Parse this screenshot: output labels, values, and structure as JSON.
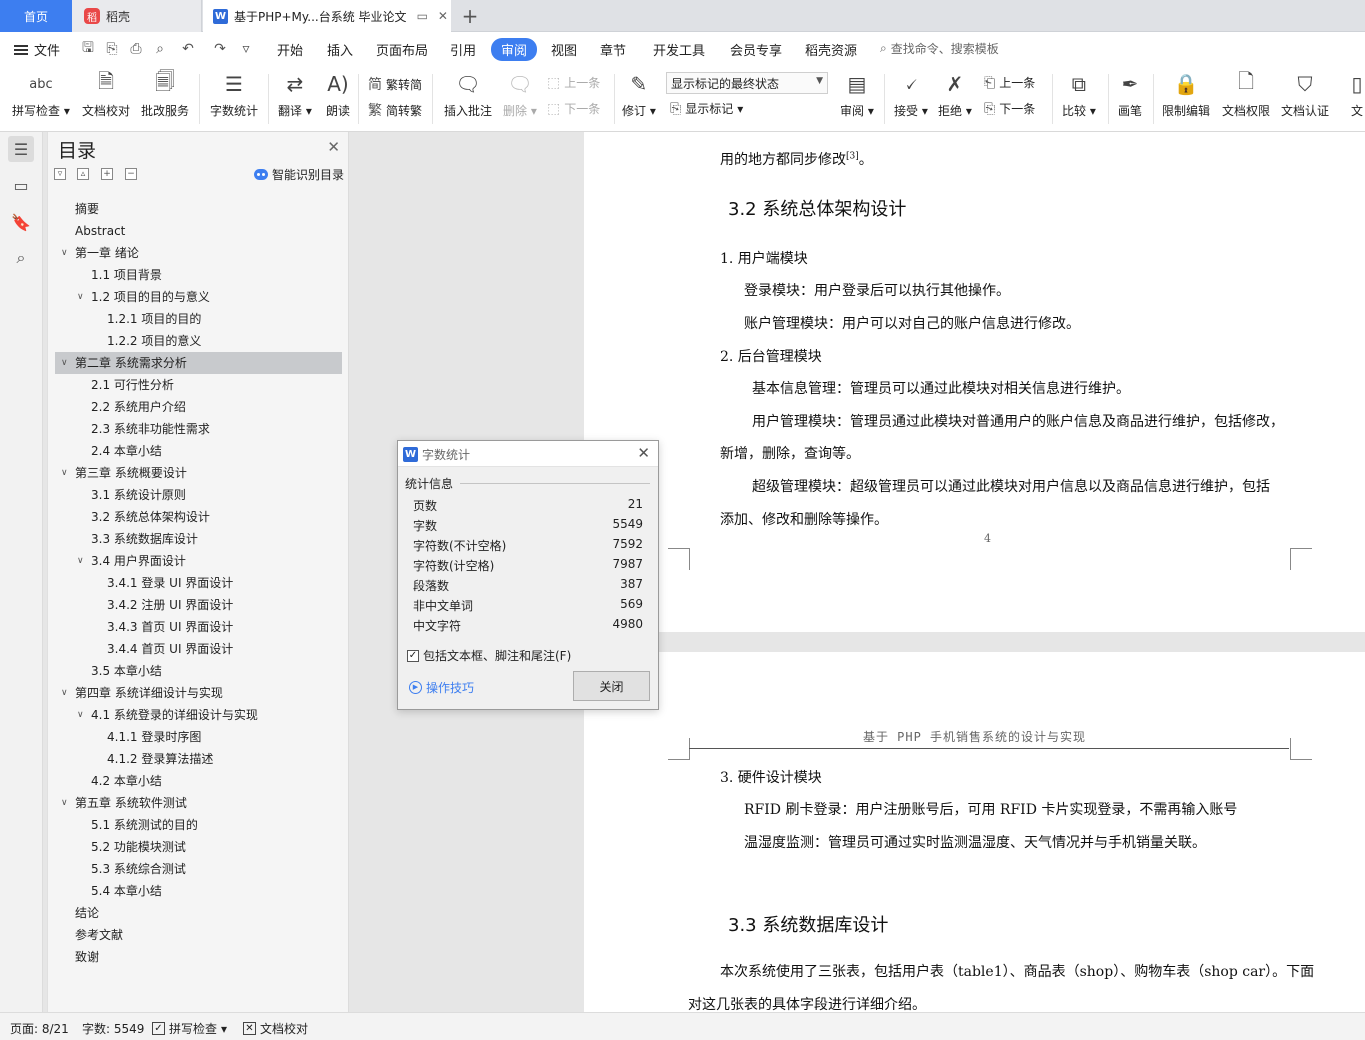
{
  "tabs": {
    "home": "首页",
    "daoke": "稻壳",
    "doc": "基于PHP+My...台系统 毕业论文"
  },
  "menubar": {
    "file": "文件",
    "items": [
      "开始",
      "插入",
      "页面布局",
      "引用",
      "审阅",
      "视图",
      "章节",
      "开发工具",
      "会员专享",
      "稻壳资源"
    ],
    "active": "审阅",
    "search": "查找命令、搜索模板"
  },
  "ribbon": {
    "spell_check": "拼写检查",
    "doc_proof": "文档校对",
    "batch_service": "批改服务",
    "word_count": "字数统计",
    "translate": "翻译",
    "read_aloud": "朗读",
    "trad_to_simp": "繁转简",
    "simp_to_trad": "简转繁",
    "insert_comment": "插入批注",
    "delete": "删除",
    "prev_comment": "上一条",
    "next_comment": "下一条",
    "track_changes": "修订",
    "markup_mode": "显示标记的最终状态",
    "show_markup": "显示标记",
    "review": "审阅",
    "accept": "接受",
    "reject": "拒绝",
    "prev_change": "上一条",
    "next_change": "下一条",
    "compare": "比较",
    "pen": "画笔",
    "restrict_edit": "限制编辑",
    "doc_permission": "文档权限",
    "doc_cert": "文档认证",
    "doc_more": "文"
  },
  "toc": {
    "title": "目录",
    "smart": "智能识别目录",
    "items": [
      {
        "text": "摘要",
        "level": 1,
        "chev": ""
      },
      {
        "text": "Abstract",
        "level": 1,
        "chev": ""
      },
      {
        "text": "第一章  绪论",
        "level": 1,
        "chev": "v"
      },
      {
        "text": "1.1  项目背景",
        "level": 2,
        "chev": ""
      },
      {
        "text": "1.2  项目的目的与意义",
        "level": 2,
        "chev": "v"
      },
      {
        "text": "1.2.1  项目的目的",
        "level": 3,
        "chev": ""
      },
      {
        "text": "1.2.2  项目的意义",
        "level": 3,
        "chev": ""
      },
      {
        "text": "第二章  系统需求分析",
        "level": 1,
        "chev": "v",
        "selected": true
      },
      {
        "text": "2.1  可行性分析",
        "level": 2,
        "chev": ""
      },
      {
        "text": "2.2 系统用户介绍",
        "level": 2,
        "chev": ""
      },
      {
        "text": "2.3  系统非功能性需求",
        "level": 2,
        "chev": ""
      },
      {
        "text": "2.4  本章小结",
        "level": 2,
        "chev": ""
      },
      {
        "text": "第三章  系统概要设计",
        "level": 1,
        "chev": "v"
      },
      {
        "text": "3.1  系统设计原则",
        "level": 2,
        "chev": ""
      },
      {
        "text": "3.2  系统总体架构设计",
        "level": 2,
        "chev": ""
      },
      {
        "text": "3.3  系统数据库设计",
        "level": 2,
        "chev": ""
      },
      {
        "text": "3.4  用户界面设计",
        "level": 2,
        "chev": "v"
      },
      {
        "text": "3.4.1  登录 UI 界面设计",
        "level": 3,
        "chev": ""
      },
      {
        "text": "3.4.2 注册  UI 界面设计",
        "level": 3,
        "chev": ""
      },
      {
        "text": "3.4.3 首页 UI 界面设计",
        "level": 3,
        "chev": ""
      },
      {
        "text": "3.4.4 首页 UI 界面设计",
        "level": 3,
        "chev": ""
      },
      {
        "text": "3.5  本章小结",
        "level": 2,
        "chev": ""
      },
      {
        "text": "第四章  系统详细设计与实现",
        "level": 1,
        "chev": "v"
      },
      {
        "text": "4.1  系统登录的详细设计与实现",
        "level": 2,
        "chev": "v"
      },
      {
        "text": "4.1.1  登录时序图",
        "level": 3,
        "chev": ""
      },
      {
        "text": "4.1.2  登录算法描述",
        "level": 3,
        "chev": ""
      },
      {
        "text": "4.2  本章小结",
        "level": 2,
        "chev": ""
      },
      {
        "text": "第五章  系统软件测试",
        "level": 1,
        "chev": "v"
      },
      {
        "text": "5.1  系统测试的目的",
        "level": 2,
        "chev": ""
      },
      {
        "text": "5.2  功能模块测试",
        "level": 2,
        "chev": ""
      },
      {
        "text": "5.3  系统综合测试",
        "level": 2,
        "chev": ""
      },
      {
        "text": "5.4  本章小结",
        "level": 2,
        "chev": ""
      },
      {
        "text": "结论",
        "level": 1,
        "chev": ""
      },
      {
        "text": "参考文献",
        "level": 1,
        "chev": ""
      },
      {
        "text": "致谢",
        "level": 1,
        "chev": ""
      }
    ]
  },
  "doc": {
    "p1_line0": "用的地方都同步修改",
    "p1_line0_sup": "[3]",
    "p1_line0_end": "。",
    "heading_32": "3.2  系统总体架构设计",
    "item1": "1.   用户端模块",
    "item1_a": "登录模块：用户登录后可以执行其他操作。",
    "item1_b": "账户管理模块：用户可以对自己的账户信息进行修改。",
    "item2": "2.   后台管理模块",
    "item2_a": "基本信息管理：管理员可以通过此模块对相关信息进行维护。",
    "item2_b1": "用户管理模块：管理员通过此模块对普通用户的账户信息及商品进行维护，包括修改，",
    "item2_b2": "新增，删除，查询等。",
    "item2_c1": "超级管理模块：超级管理员可以通过此模块对用户信息以及商品信息进行维护，包括",
    "item2_c2": "添加、修改和删除等操作。",
    "page_num": "4",
    "running_head": "基于 PHP 手机销售系统的设计与实现",
    "item3": "3.   硬件设计模块",
    "item3_a": "RFID 刷卡登录：用户注册账号后，可用 RFID 卡片实现登录，不需再输入账号",
    "item3_b": "温湿度监测：管理员可通过实时监测温湿度、天气情况并与手机销量关联。",
    "heading_33": "3.3  系统数据库设计",
    "p33_1": "本次系统使用了三张表，包括用户表（table1）、商品表（shop）、购物车表（shop car）。下面",
    "p33_2": "对这几张表的具体字段进行详细介绍。"
  },
  "dialog": {
    "title": "字数统计",
    "section": "统计信息",
    "rows": [
      {
        "label": "页数",
        "value": "21"
      },
      {
        "label": "字数",
        "value": "5549"
      },
      {
        "label": "字符数(不计空格)",
        "value": "7592"
      },
      {
        "label": "字符数(计空格)",
        "value": "7987"
      },
      {
        "label": "段落数",
        "value": "387"
      },
      {
        "label": "非中文单词",
        "value": "569"
      },
      {
        "label": "中文字符",
        "value": "4980"
      }
    ],
    "checkbox_label": "包括文本框、脚注和尾注(F)",
    "checkbox_checked": true,
    "tips": "操作技巧",
    "close_btn": "关闭"
  },
  "status": {
    "page": "页面: 8/21",
    "words": "字数: 5549",
    "spell": "拼写检查",
    "proof": "文档校对"
  },
  "colors": {
    "accent": "#3d7ef0",
    "toc_selected": "#c8cacd"
  }
}
